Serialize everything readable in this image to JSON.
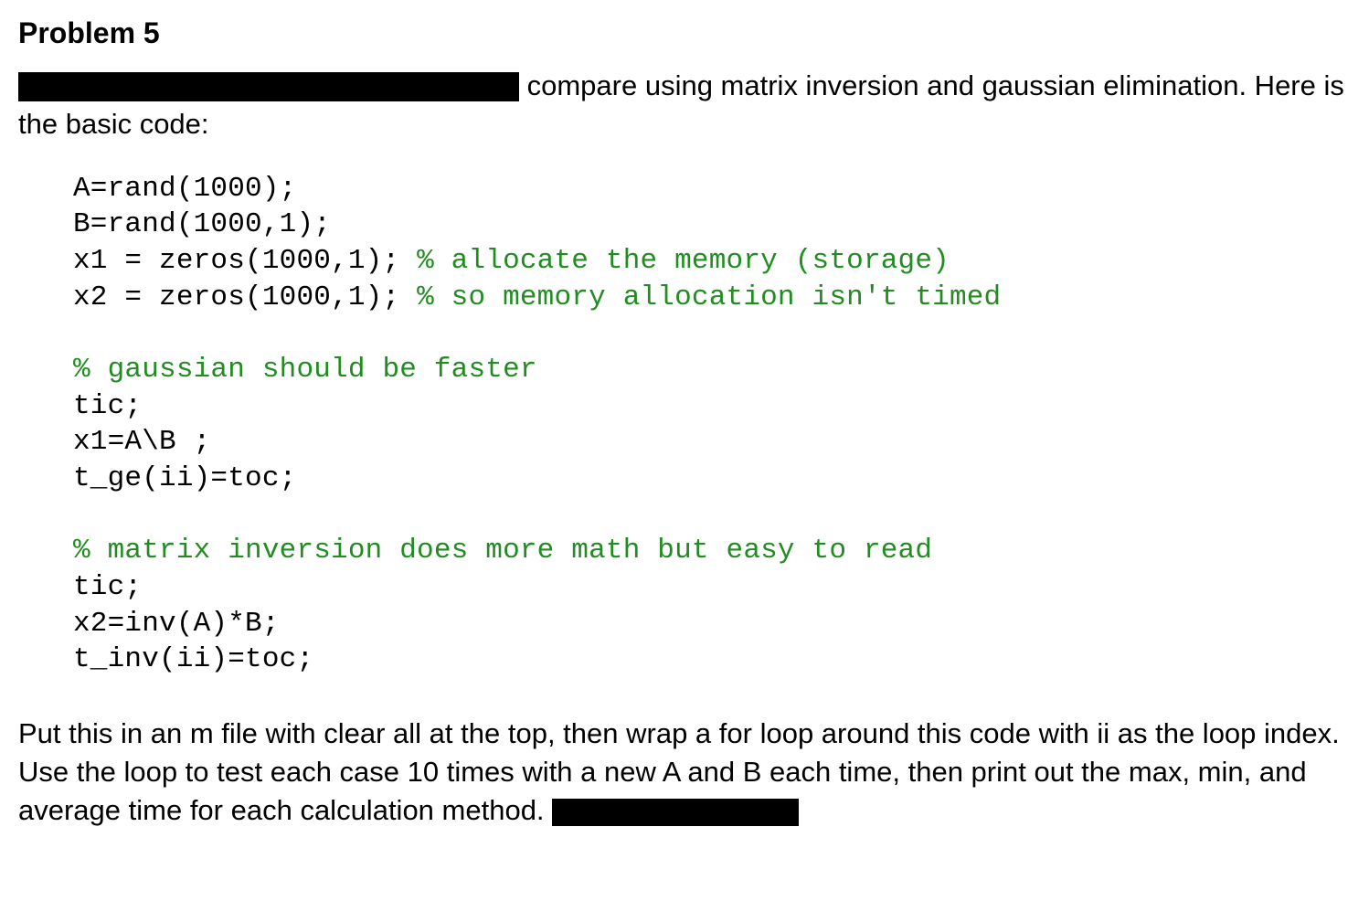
{
  "title": "Problem 5",
  "intro": {
    "part1": " compare using matrix inversion and gaussian elimination.  Here is the basic code:"
  },
  "code": {
    "l1": "A=rand(1000);",
    "l2": "B=rand(1000,1);",
    "l3a": "x1 = zeros(1000,1); ",
    "l3b": "% allocate the memory (storage)",
    "l4a": "x2 = zeros(1000,1); ",
    "l4b": "% so memory allocation isn't timed",
    "l5": "",
    "l6": "% gaussian should be faster",
    "l7": "tic;",
    "l8": "x1=A\\B ;",
    "l9": "t_ge(ii)=toc;",
    "l10": "",
    "l11": "% matrix inversion does more math but easy to read",
    "l12": "tic;",
    "l13": "x2=inv(A)*B;",
    "l14": "t_inv(ii)=toc;"
  },
  "instructions": {
    "text": "Put this in an m file with clear all at the top, then wrap a for loop around this code with ii as the loop index.  Use the loop to test each case 10 times with a new A and B each time, then print out the max, min, and average time for each calculation method. "
  }
}
